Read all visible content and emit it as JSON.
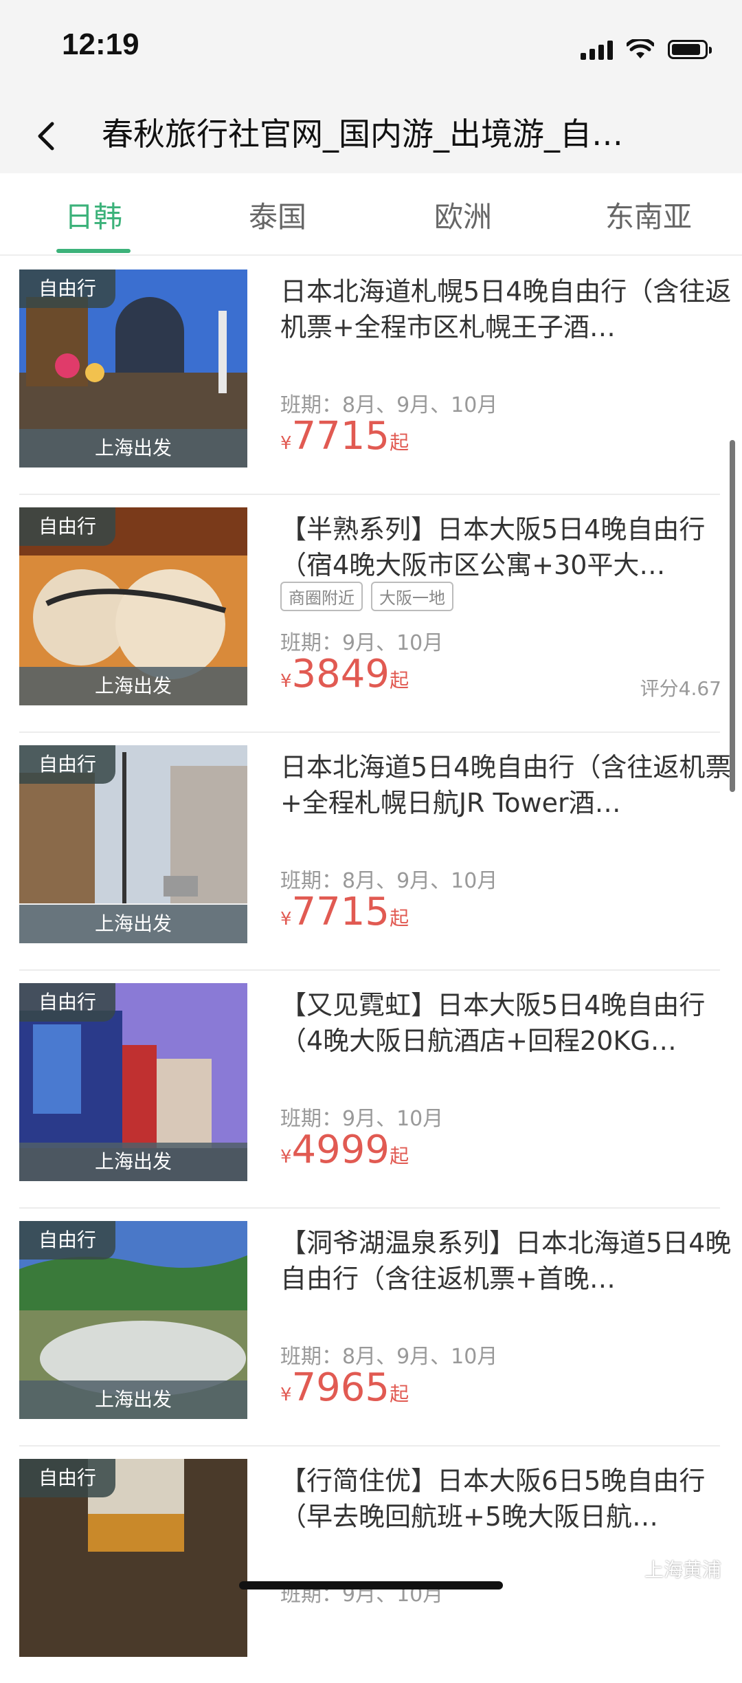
{
  "status": {
    "time": "12:19"
  },
  "nav": {
    "title": "春秋旅行社官网_国内游_出境游_自…"
  },
  "tabs": [
    "日韩",
    "泰国",
    "欧洲",
    "东南亚"
  ],
  "colors": {
    "accent": "#3cb27a",
    "price": "#e15a52"
  },
  "items": [
    {
      "badge": "自由行",
      "depart": "上海出发",
      "title": "日本北海道札幌5日4晚自由行（含往返机票+全程市区札幌王子酒…",
      "tags": [],
      "schedule": "班期：8月、9月、10月",
      "yen": "¥",
      "price": "7715",
      "suffix": "起",
      "rating": ""
    },
    {
      "badge": "自由行",
      "depart": "上海出发",
      "title": "【半熟系列】日本大阪5日4晚自由行（宿4晚大阪市区公寓+30平大…",
      "tags": [
        "商圈附近",
        "大阪一地"
      ],
      "schedule": "班期：9月、10月",
      "yen": "¥",
      "price": "3849",
      "suffix": "起",
      "rating": "评分4.67"
    },
    {
      "badge": "自由行",
      "depart": "上海出发",
      "title": "日本北海道5日4晚自由行（含往返机票+全程札幌日航JR Tower酒…",
      "tags": [],
      "schedule": "班期：8月、9月、10月",
      "yen": "¥",
      "price": "7715",
      "suffix": "起",
      "rating": ""
    },
    {
      "badge": "自由行",
      "depart": "上海出发",
      "title": "【又见霓虹】日本大阪5日4晚自由行（4晚大阪日航酒店+回程20KG…",
      "tags": [],
      "schedule": "班期：9月、10月",
      "yen": "¥",
      "price": "4999",
      "suffix": "起",
      "rating": ""
    },
    {
      "badge": "自由行",
      "depart": "上海出发",
      "title": "【洞爷湖温泉系列】日本北海道5日4晚自由行（含往返机票+首晚…",
      "tags": [],
      "schedule": "班期：8月、9月、10月",
      "yen": "¥",
      "price": "7965",
      "suffix": "起",
      "rating": ""
    },
    {
      "badge": "自由行",
      "depart": "",
      "title": "【行简住优】日本大阪6日5晚自由行（早去晚回航班+5晚大阪日航…",
      "tags": [],
      "schedule": "班期：9月、10月",
      "yen": "",
      "price": "",
      "suffix": "",
      "rating": ""
    }
  ],
  "watermark": "上海黄浦"
}
